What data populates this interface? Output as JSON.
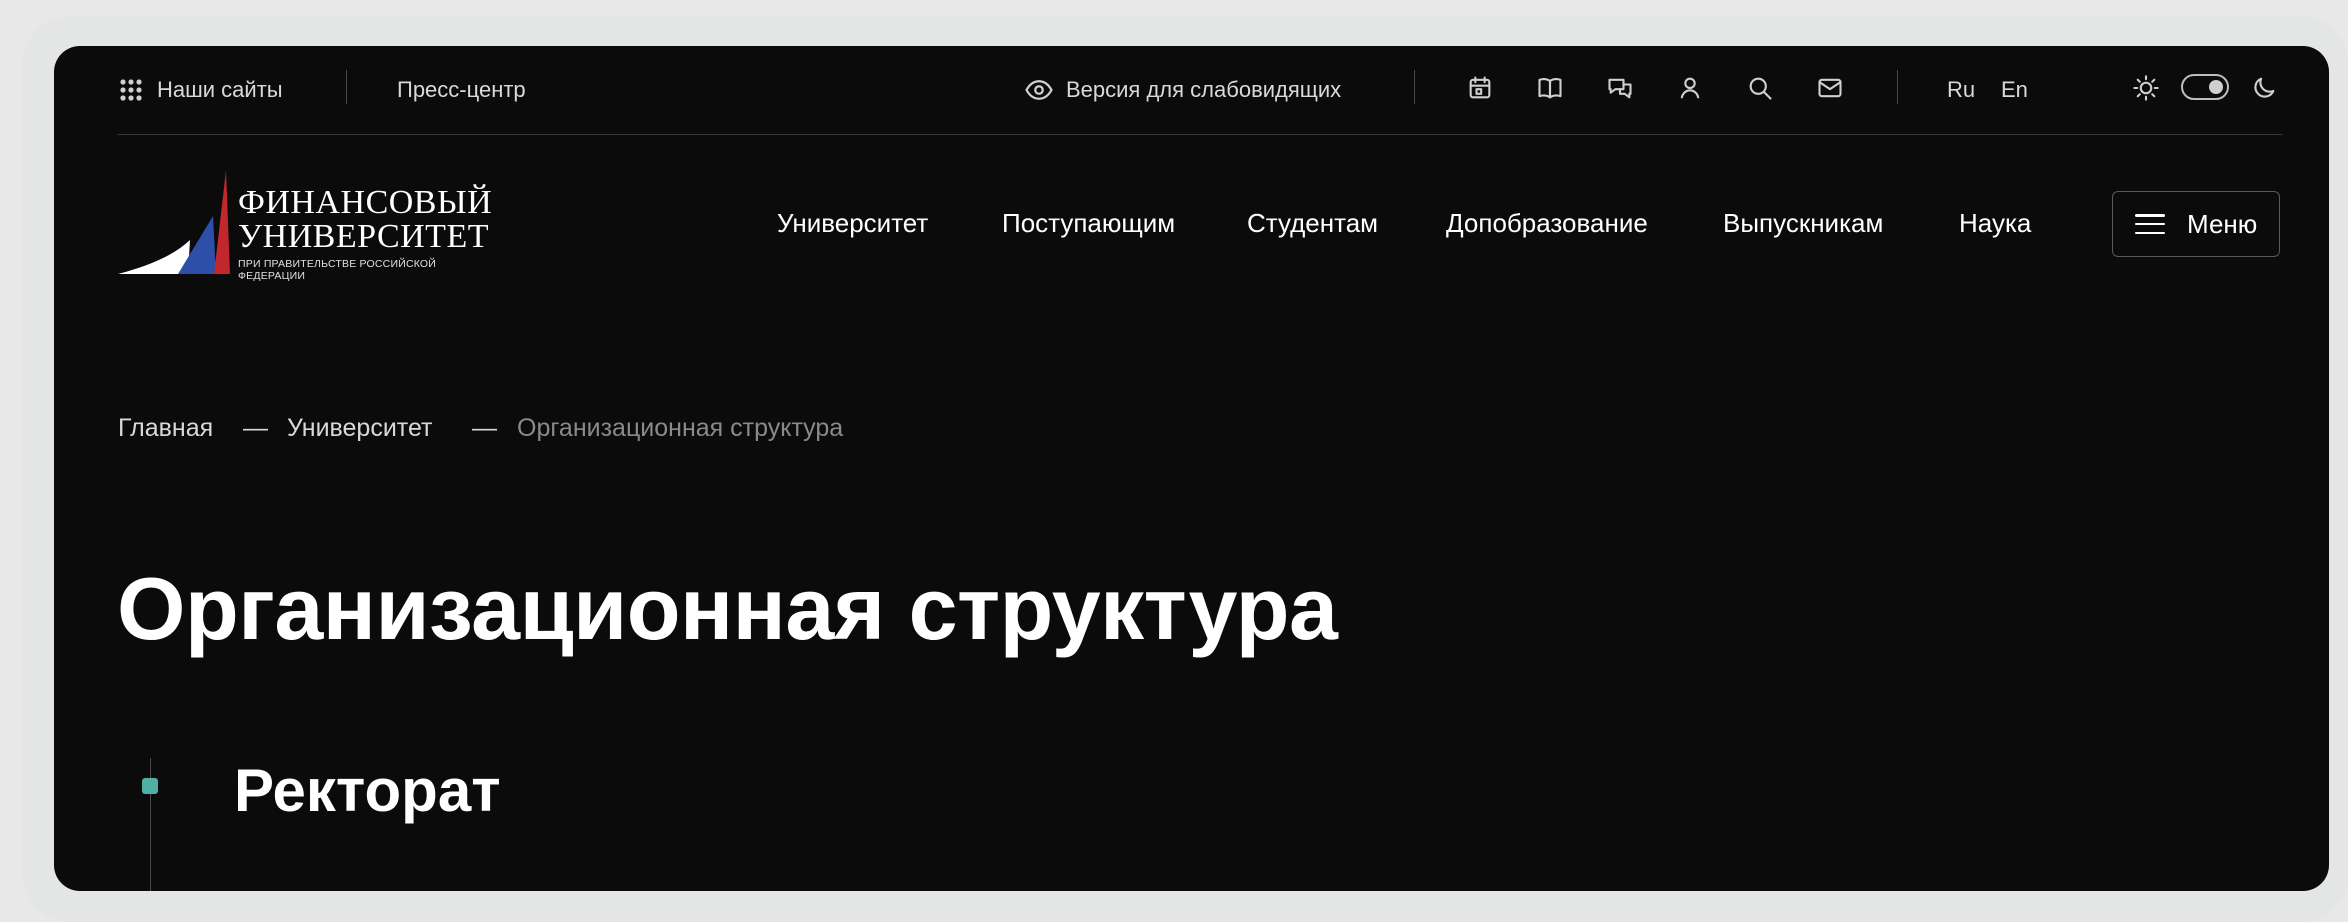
{
  "topbar": {
    "our_sites": "Наши сайты",
    "press_center": "Пресс-центр",
    "accessibility": "Версия для слабовидящих",
    "icons": [
      "calendar-icon",
      "book-icon",
      "chat-icon",
      "user-icon",
      "search-icon",
      "mail-icon"
    ],
    "lang_ru": "Ru",
    "lang_en": "En",
    "theme": "dark"
  },
  "logo": {
    "line1": "ФИНАНСОВЫЙ",
    "line2": "УНИВЕРСИТЕТ",
    "line3": "ПРИ ПРАВИТЕЛЬСТВЕ РОССИЙСКОЙ ФЕДЕРАЦИИ",
    "colors": {
      "white": "#ffffff",
      "blue": "#2d4fa8",
      "red": "#c0282d"
    }
  },
  "nav": {
    "items": [
      "Университет",
      "Поступающим",
      "Студентам",
      "Допобразование",
      "Выпускникам",
      "Наука"
    ],
    "menu_label": "Меню"
  },
  "breadcrumb": {
    "home": "Главная",
    "sep": "—",
    "parent": "Университет",
    "current": "Организационная структура"
  },
  "page": {
    "title": "Организационная структура",
    "section_title": "Ректорат",
    "accent_color": "#4fb0a6"
  }
}
